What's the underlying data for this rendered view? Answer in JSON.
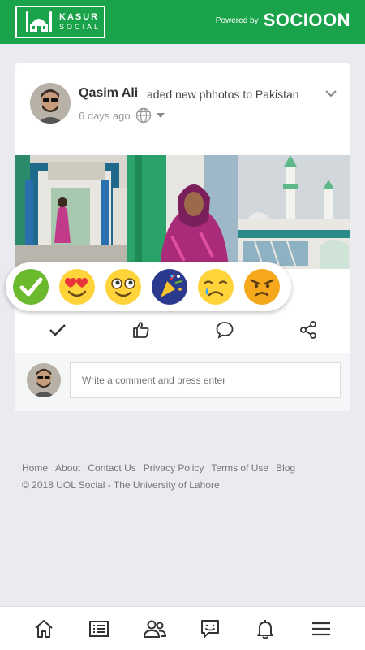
{
  "header": {
    "logo_title": "KASUR",
    "logo_subtitle": "SOCIAL",
    "powered_label": "Powered by",
    "powered_brand": "SOCIOON"
  },
  "post": {
    "author": "Qasim Ali",
    "action": "aded new phhotos to Pakistan",
    "time": "6 days ago",
    "photos": [
      "shrine-gate-photo",
      "woman-portrait-photo",
      "mosque-minaret-photo"
    ]
  },
  "reactions": [
    "check-reaction",
    "love-eyes-reaction",
    "wow-reaction",
    "celebrate-reaction",
    "sad-reaction",
    "angry-reaction"
  ],
  "actions": [
    "check-icon",
    "like-icon",
    "comment-icon",
    "share-icon"
  ],
  "comment": {
    "placeholder": "Write a comment and press enter"
  },
  "footer": {
    "links": [
      "Home",
      "About",
      "Contact Us",
      "Privacy Policy",
      "Terms of Use",
      "Blog"
    ],
    "copyright": "© 2018 UOL Social - The University of Lahore"
  },
  "colors": {
    "brand_green": "#1aa34a",
    "background": "#e9ebee"
  }
}
